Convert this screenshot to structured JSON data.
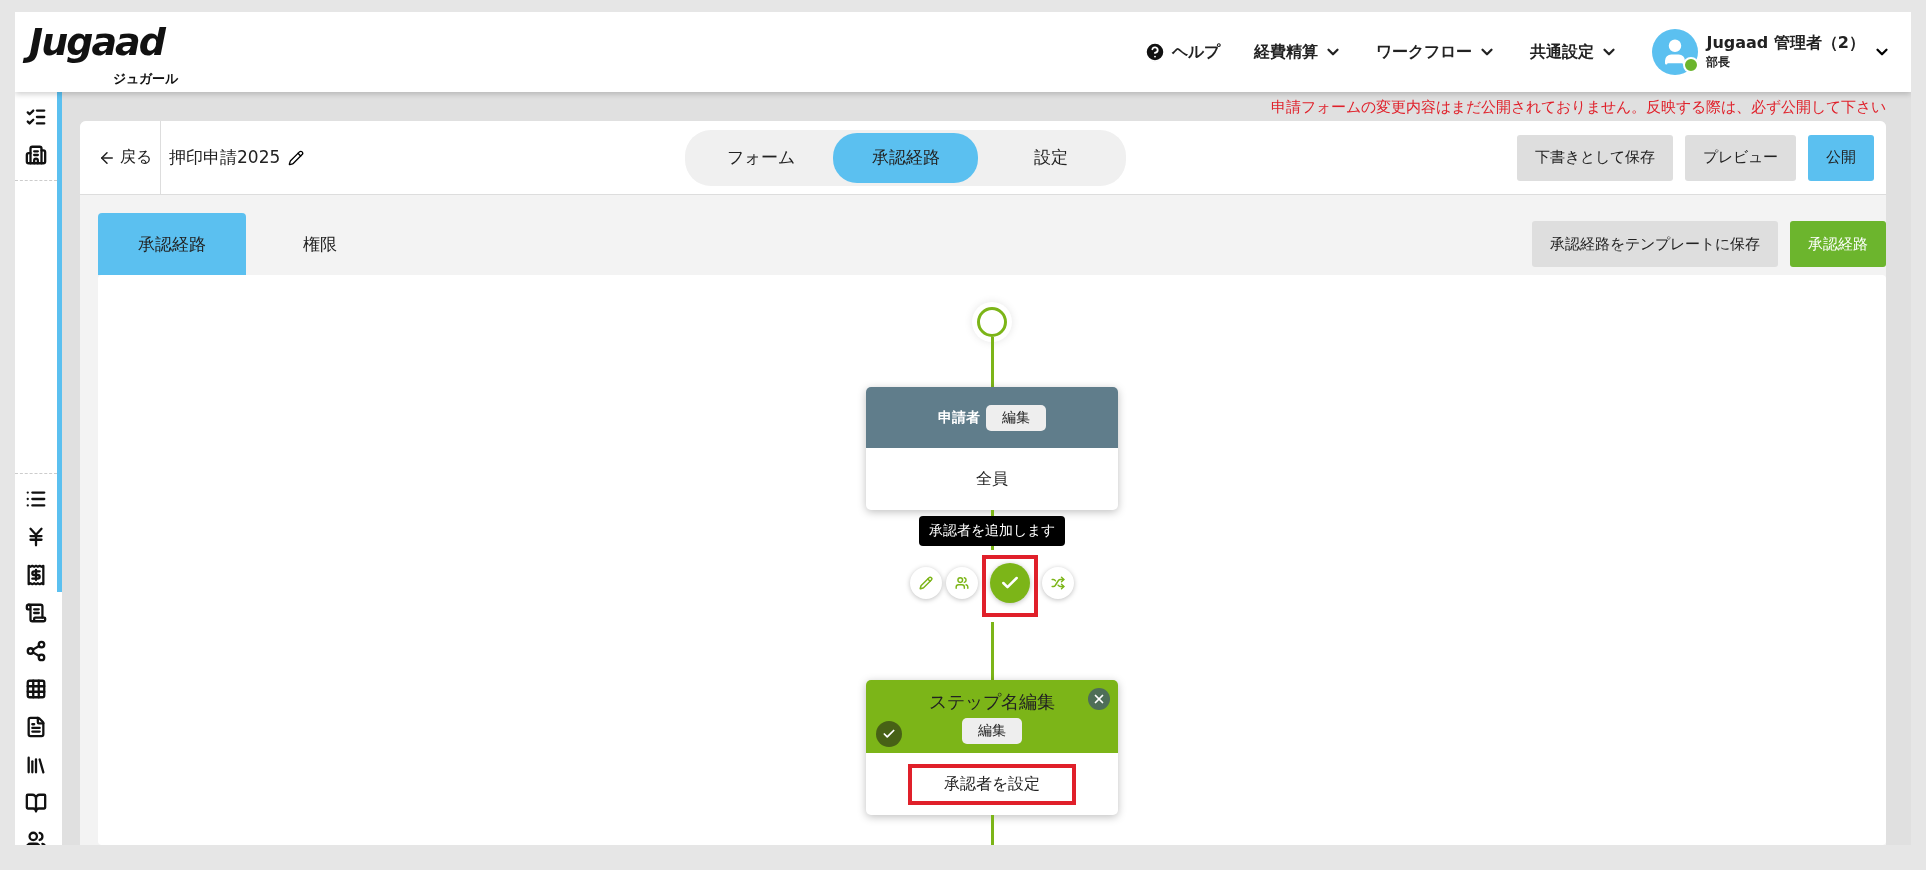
{
  "header": {
    "logo": "Jugaad",
    "logo_sub": "ジュガール",
    "nav": [
      {
        "kind": "help",
        "label": "ヘルプ"
      },
      {
        "kind": "menu",
        "label": "経費精算"
      },
      {
        "kind": "menu",
        "label": "ワークフロー"
      },
      {
        "kind": "menu",
        "label": "共通設定"
      }
    ],
    "user": {
      "name": "Jugaad 管理者（2）",
      "role": "部長",
      "online": true
    }
  },
  "warning": "申請フォームの変更内容はまだ公開されておりません。反映する際は、必ず公開して下さい",
  "toolbar": {
    "back": "戻る",
    "form_name": "押印申請2025",
    "segments": [
      {
        "label": "フォーム",
        "selected": false
      },
      {
        "label": "承認経路",
        "selected": true
      },
      {
        "label": "設定",
        "selected": false
      }
    ],
    "actions": [
      {
        "label": "下書きとして保存",
        "kind": "plain"
      },
      {
        "label": "プレビュー",
        "kind": "plain"
      },
      {
        "label": "公開",
        "kind": "primary"
      }
    ]
  },
  "tabs": [
    {
      "label": "承認経路",
      "selected": true
    },
    {
      "label": "権限",
      "selected": false
    }
  ],
  "tab_actions": [
    {
      "label": "承認経路をテンプレートに保存",
      "kind": "plain"
    },
    {
      "label": "承認経路",
      "kind": "green"
    }
  ],
  "flow": {
    "applicant": {
      "title": "申請者",
      "edit": "編集",
      "body": "全員"
    },
    "tooltip": "承認者を追加します",
    "tools": [
      {
        "kind": "edit",
        "highlighted": false
      },
      {
        "kind": "group",
        "highlighted": false
      },
      {
        "kind": "approver",
        "highlighted": true
      },
      {
        "kind": "shuffle",
        "highlighted": false
      }
    ],
    "step": {
      "title": "ステップ名編集",
      "edit": "編集",
      "body": "承認者を設定",
      "body_highlighted": true
    }
  }
}
